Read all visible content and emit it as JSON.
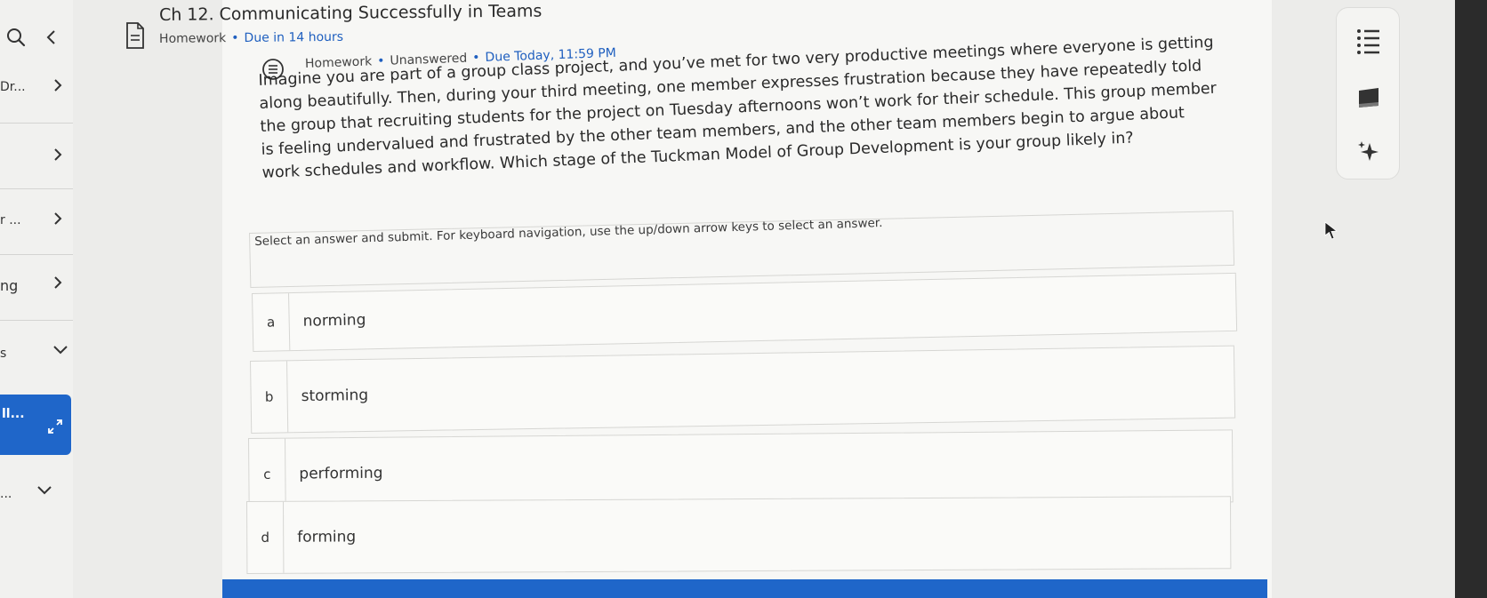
{
  "sidebar": {
    "items": [
      {
        "label": "Dr...",
        "chevron": "chevron-right"
      },
      {
        "label": "",
        "chevron": "chevron-right"
      },
      {
        "label": "r ...",
        "chevron": "chevron-right"
      },
      {
        "label": "ng",
        "chevron": "chevron-right"
      },
      {
        "label": "s",
        "chevron": "chevron-down"
      }
    ],
    "active_item": {
      "label": "ll...",
      "icon": "expand-icon"
    },
    "last_item": {
      "label": "...",
      "chevron": "chevron-down"
    }
  },
  "header": {
    "title": "Ch 12. Communicating Successfully in Teams",
    "type": "Homework",
    "due": "Due in 14 hours"
  },
  "question_meta": {
    "type": "Homework",
    "status": "Unanswered",
    "due": "Due Today, 11:59 PM"
  },
  "question": {
    "text": "Imagine you are part of a group class project, and you’ve met for two very productive meetings where everyone is getting along beautifully. Then, during your third meeting, one member expresses frustration because they have repeatedly told the group that recruiting students for the project on Tuesday afternoons won’t work for their schedule. This group member is feeling undervalued and frustrated by the other team members, and the other team members begin to argue about work schedules and workflow. Which stage of the Tuckman Model of Group Development is your group likely in?",
    "instructions": "Select an answer and submit. For keyboard navigation, use the up/down arrow keys to select an answer."
  },
  "options": [
    {
      "letter": "a",
      "text": "norming"
    },
    {
      "letter": "b",
      "text": "storming"
    },
    {
      "letter": "c",
      "text": "performing"
    },
    {
      "letter": "d",
      "text": "forming"
    }
  ],
  "toolbar": {
    "icons": [
      "list-icon",
      "notebook-icon",
      "sparkle-icon"
    ]
  },
  "colors": {
    "accent": "#1f66c9",
    "due_text": "#1f5fbf",
    "background": "#f7f7f5"
  }
}
